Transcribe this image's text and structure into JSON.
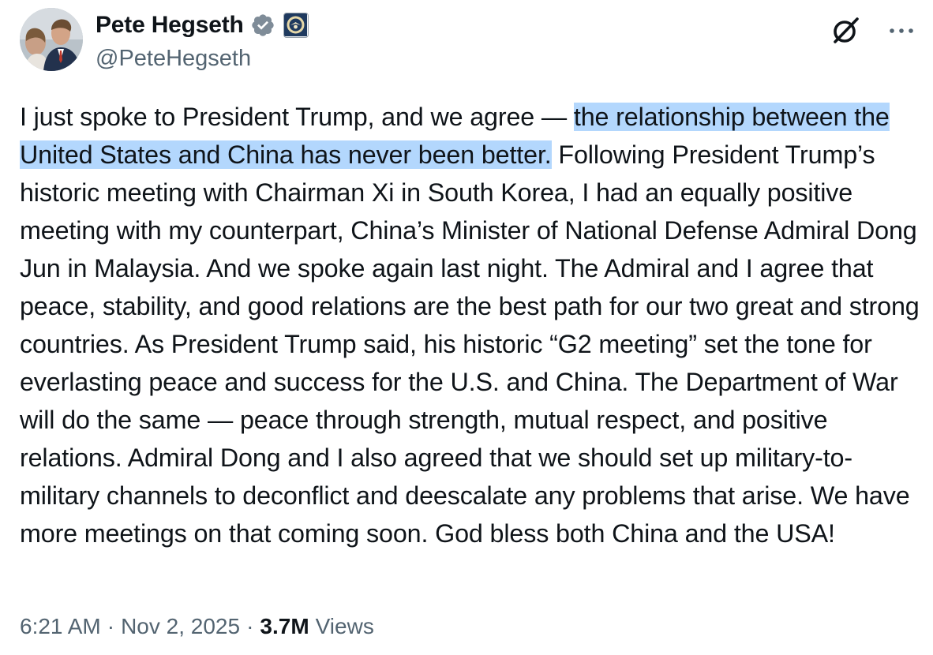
{
  "tweet": {
    "display_name": "Pete Hegseth",
    "handle": "@PeteHegseth",
    "verified_icon": "verified-badge-icon",
    "affiliate_icon": "department-seal-icon",
    "body_before_highlight": "I just spoke to President Trump, and we agree — ",
    "body_highlight": "the relationship between the United States and China has never been better.",
    "body_after_highlight": " Following President Trump’s historic meeting with Chairman Xi in South Korea, I had an equally positive meeting with my counterpart, China’s Minister of National Defense Admiral Dong Jun in Malaysia. And we spoke again last night. The Admiral and I agree that peace, stability, and good relations are the best path for our two great and strong countries. As President Trump said, his historic “G2 meeting” set the tone for everlasting peace and success for the U.S. and China. The Department of War will do the same — peace through strength, mutual respect, and positive relations. Admiral Dong and I also agreed that we should set up military-to-military channels to deconflict and deescalate any problems that arise. We have more meetings on that coming soon. God bless both China and the USA!",
    "time": "6:21 AM",
    "date": "Nov 2, 2025",
    "separator": "·",
    "views_count": "3.7M",
    "views_label": "Views"
  },
  "colors": {
    "text_primary": "#0f1419",
    "text_secondary": "#536471",
    "verified_blue": "#1d9bf0",
    "selection_highlight": "#b3d7fd"
  },
  "icons": {
    "grok": "grok-icon",
    "more": "more-options-icon"
  }
}
